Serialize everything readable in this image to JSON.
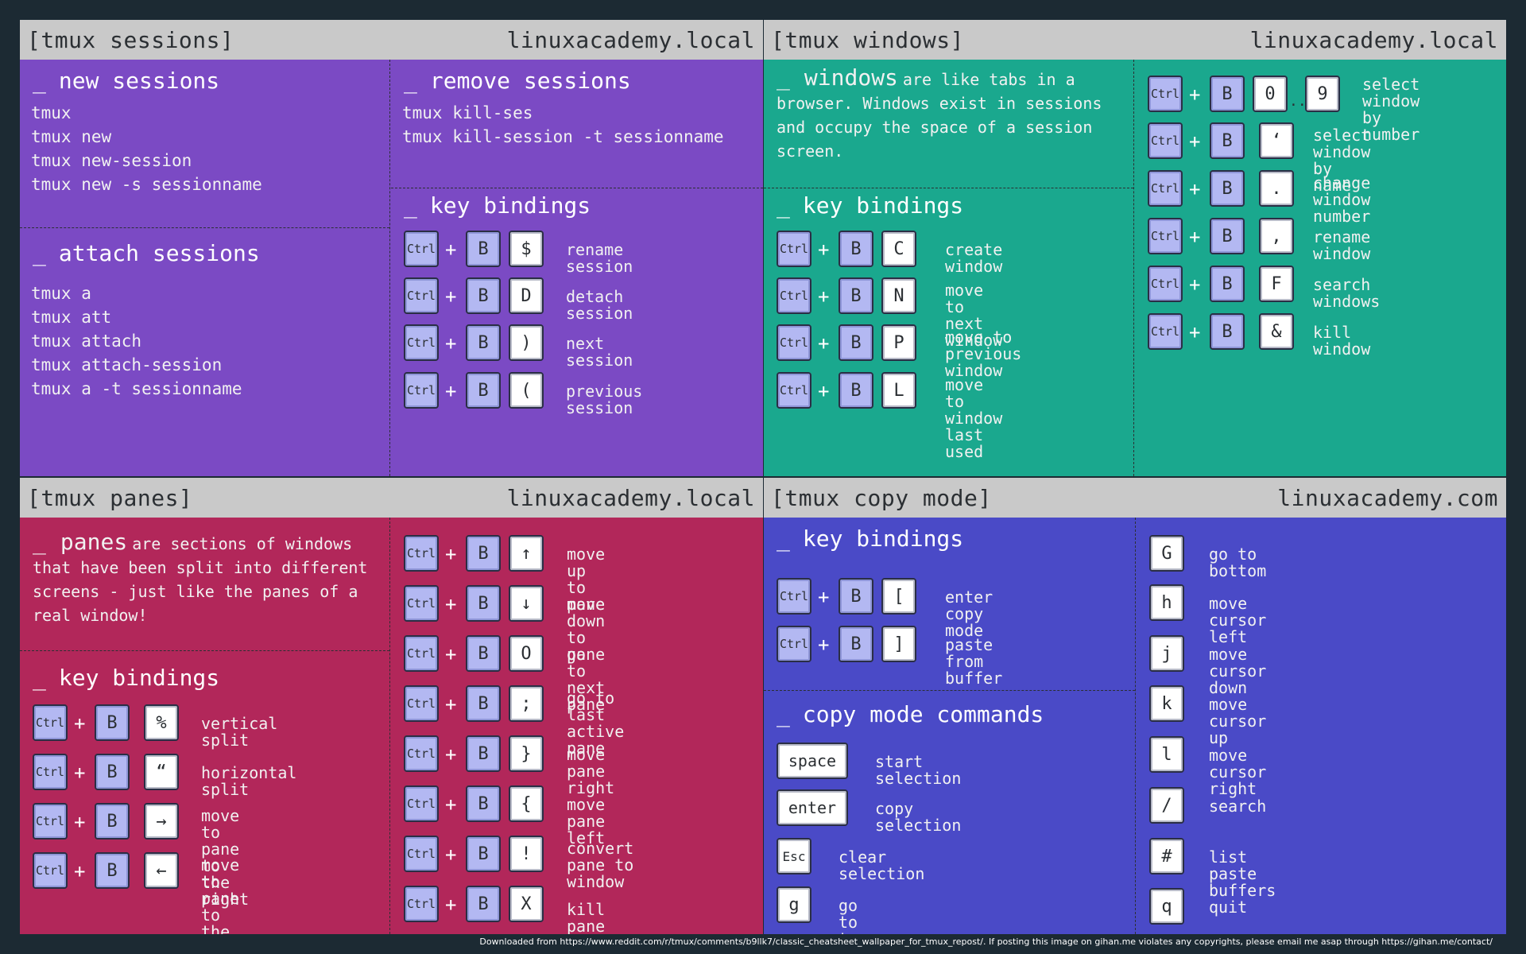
{
  "sessions": {
    "title": "[tmux sessions]",
    "host": "linuxacademy.local",
    "new": {
      "heading": "new sessions",
      "commands": [
        "tmux",
        "tmux new",
        "tmux new-session",
        "tmux new -s sessionname"
      ]
    },
    "attach": {
      "heading": "attach sessions",
      "commands": [
        "tmux a",
        "tmux att",
        "tmux attach",
        "tmux attach-session",
        "tmux a -t sessionname"
      ]
    },
    "remove": {
      "heading": "remove sessions",
      "commands": [
        "tmux kill-ses",
        "tmux kill-session -t sessionname"
      ]
    },
    "keys": {
      "heading": "key bindings",
      "bindings": [
        {
          "key": "$",
          "desc": "rename session"
        },
        {
          "key": "D",
          "desc": "detach session"
        },
        {
          "key": ")",
          "desc": "next session"
        },
        {
          "key": "(",
          "desc": "previous session"
        }
      ]
    }
  },
  "windows": {
    "title": "[tmux windows]",
    "host": "linuxacademy.local",
    "intro_word": "windows",
    "intro_rest": "are like tabs in a browser. Windows exist in sessions and occupy the space of a session screen.",
    "keys": {
      "heading": "key bindings",
      "bindings": [
        {
          "key": "C",
          "desc": [
            "create window"
          ]
        },
        {
          "key": "N",
          "desc": [
            "move to next",
            "window"
          ]
        },
        {
          "key": "P",
          "desc": [
            "move to previous",
            "window"
          ]
        },
        {
          "key": "L",
          "desc": [
            "move to window",
            "last used"
          ]
        }
      ]
    },
    "more": [
      {
        "key": "0",
        "key2": "9",
        "desc": [
          "select window",
          "by number"
        ]
      },
      {
        "key": "‘",
        "desc": [
          "select window",
          "by name"
        ]
      },
      {
        "key": ".",
        "desc": [
          "change window",
          "number"
        ]
      },
      {
        "key": ",",
        "desc": [
          "rename window"
        ]
      },
      {
        "key": "F",
        "desc": [
          "search windows"
        ]
      },
      {
        "key": "&",
        "desc": [
          "kill window"
        ]
      }
    ],
    "dots": ".."
  },
  "panes": {
    "title": "[tmux panes]",
    "host": "linuxacademy.local",
    "intro_word": "panes",
    "intro_rest": "are sections of windows that have been split into different screens - just like the panes of a real window!",
    "keys": {
      "heading": "key bindings",
      "bindings": [
        {
          "key": "%",
          "desc": [
            "vertical split"
          ]
        },
        {
          "key": "“",
          "desc": [
            "horizontal split"
          ]
        },
        {
          "key": "→",
          "desc": [
            "move to pane to",
            "the right"
          ]
        },
        {
          "key": "←",
          "desc": [
            "move to pane to",
            "the left"
          ]
        }
      ]
    },
    "more": [
      {
        "key": "↑",
        "desc": [
          "move up to pane"
        ]
      },
      {
        "key": "↓",
        "desc": [
          "move down to pane"
        ]
      },
      {
        "key": "O",
        "desc": [
          "go to next pane"
        ]
      },
      {
        "key": ";",
        "desc": [
          "go to last active",
          "pane"
        ]
      },
      {
        "key": "}",
        "desc": [
          "move pane right"
        ]
      },
      {
        "key": "{",
        "desc": [
          "move pane left"
        ]
      },
      {
        "key": "!",
        "desc": [
          "convert pane to",
          "window"
        ]
      },
      {
        "key": "X",
        "desc": [
          "kill pane"
        ]
      }
    ]
  },
  "copy": {
    "title": "[tmux copy mode]",
    "host": "linuxacademy.com",
    "keys": {
      "heading": "key bindings",
      "bindings": [
        {
          "key": "[",
          "desc": [
            "enter copy mode"
          ]
        },
        {
          "key": "]",
          "desc": [
            "paste from buffer"
          ]
        }
      ]
    },
    "commands": {
      "heading": "copy mode commands",
      "items": [
        {
          "key": "space",
          "desc": "start selection"
        },
        {
          "key": "enter",
          "desc": "copy selection"
        },
        {
          "key": "Esc",
          "desc": "clear selection"
        },
        {
          "key": "g",
          "desc": "go to top"
        }
      ]
    },
    "more": [
      {
        "key": "G",
        "desc": "go to bottom"
      },
      {
        "key": "h",
        "desc": "move cursor left"
      },
      {
        "key": "j",
        "desc": "move cursor down"
      },
      {
        "key": "k",
        "desc": "move cursor up"
      },
      {
        "key": "l",
        "desc": "move cursor right"
      },
      {
        "key": "/",
        "desc": "search"
      },
      {
        "key": "#",
        "desc": "list paste buffers"
      },
      {
        "key": "q",
        "desc": "quit"
      }
    ]
  },
  "common": {
    "ctrl": "Ctrl",
    "b": "B",
    "plus": "+",
    "underscore": "_"
  },
  "footer": "Downloaded from https://www.reddit.com/r/tmux/comments/b9llk7/classic_cheatsheet_wallpaper_for_tmux_repost/. If posting this image on gihan.me violates any copyrights, please email me asap through https://gihan.me/contact/"
}
